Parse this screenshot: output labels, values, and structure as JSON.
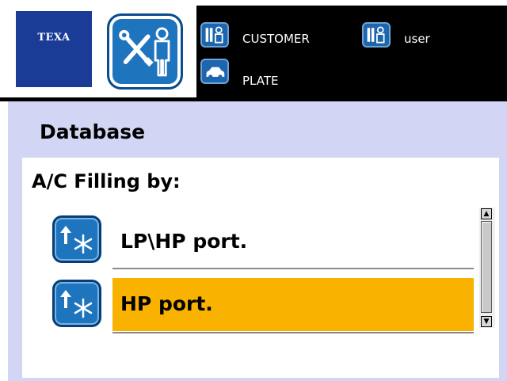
{
  "header": {
    "logo_text": "TEXA",
    "customer_label": "CUSTOMER",
    "user_label": "user",
    "plate_label": "PLATE"
  },
  "icons": {
    "main": "tools-person-icon",
    "customer": "person-icon",
    "user": "person-icon",
    "plate": "car-icon",
    "list_item": "ac-arrow-up-snowflake-icon"
  },
  "section_title": "Database",
  "panel": {
    "title": "A/C Filling by:",
    "items": [
      {
        "label": "LP\\HP port.",
        "selected": false
      },
      {
        "label": "HP port.",
        "selected": true
      }
    ]
  },
  "colors": {
    "header_bg": "#000000",
    "logo_blue": "#1a3c97",
    "icon_blue": "#1f74be",
    "section_bg": "#d3d5f5",
    "selected_row": "#f9b200"
  }
}
